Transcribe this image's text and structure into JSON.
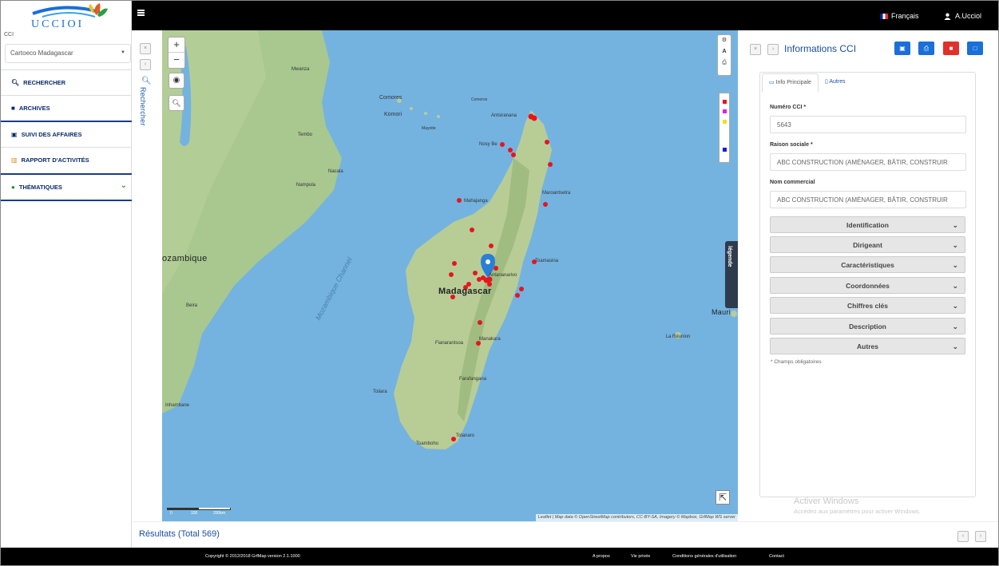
{
  "header": {
    "logo_text": "UCCIOI",
    "language": "Français",
    "user": "A.Ucciol"
  },
  "sidebar": {
    "cci_label": "CCI",
    "select_value": "Cartoeco Madagascar",
    "items": [
      {
        "label": "RECHERCHER",
        "icon": "search-icon"
      },
      {
        "label": "ARCHIVES",
        "icon": "archive-icon"
      },
      {
        "label": "SUIVI DES AFFAIRES",
        "icon": "briefcase-icon"
      },
      {
        "label": "RAPPORT D'ACTIVITÉS",
        "icon": "bar-chart-icon"
      },
      {
        "label": "THÉMATIQUES",
        "icon": "globe-icon"
      }
    ],
    "rechercher_vertical": "Rechercher"
  },
  "map": {
    "labels": {
      "mwanza": "Mwanza",
      "comores": "Comores",
      "komori": "Komori",
      "comoros": "Comoros",
      "antsiranana": "Antsiranana",
      "mayotte": "Mayotte",
      "nosybe": "Nosy Be",
      "tembo": "Tembo",
      "nacala": "Nacala",
      "nampula": "Nampula",
      "mahajanga": "Mahajanga",
      "maroantsetra": "Maroantsetra",
      "mozambique": "ozambique",
      "mozchannel": "Mozambique Channel",
      "toamasina": "Toamasina",
      "antananarivo": "Antananarivo",
      "madagascar": "Madagascar",
      "beira": "Beira",
      "mauri": "Mauri",
      "fianarantsoa": "Fianarantsoa",
      "manakara": "Manakara",
      "lareunion": "La Réunion",
      "farafangana": "Farafangana",
      "toliara": "Toliara",
      "inhambane": "Inhambane",
      "tolanaro": "Tolanaro",
      "toamboho": "Toamboho"
    },
    "legend_label": "légende",
    "attribution": "Leaflet | Map data © OpenStreetMap contributors, CC-BY-SA, Imagery © Mapbox, GrfMap WS server",
    "scale_labels": [
      "0",
      "100",
      "200km"
    ],
    "tool_icons": [
      "settings-icon",
      "font-icon",
      "print-icon"
    ],
    "legend_colors": [
      "#e8141f",
      "#e020e0",
      "#f0e020",
      "#1a1ae0"
    ],
    "marker_color": "#e8141f",
    "pin_color": "#2a7fd4"
  },
  "panel": {
    "title": "Informations CCI",
    "tabs": [
      {
        "label": "Info Principale",
        "icon": "id-card-icon"
      },
      {
        "label": "Autres",
        "icon": "document-icon"
      }
    ],
    "fields": [
      {
        "label": "Numéro CCI *",
        "value": "5643"
      },
      {
        "label": "Raison sociale *",
        "value": "ABC CONSTRUCTION (AMÉNAGER, BÂTIR, CONSTRUIR"
      },
      {
        "label": "Nom commercial",
        "value": "ABC CONSTRUCTION (AMÉNAGER, BÂTIR, CONSTRUIR"
      }
    ],
    "sections": [
      "Identification",
      "Dirigeant",
      "Caractéristiques",
      "Coordonnées",
      "Chiffres clés",
      "Description",
      "Autres"
    ],
    "required_note": "* Champs obligatoires",
    "button_colors": [
      "#1a6fd8",
      "#1a6fd8",
      "#e0312a",
      "#1a6fd8"
    ]
  },
  "watermark": {
    "line1": "Activer Windows",
    "line2": "Accédez aux paramètres pour activer Windows."
  },
  "results": {
    "label": "Résultats (Total 569)"
  },
  "footer": {
    "copyright": "Copyright © 2012/2018 GrfMap version 2.1.1000",
    "links": [
      "A propos",
      "Vie privée",
      "Conditions générales d'utilisation",
      "Contact"
    ]
  }
}
